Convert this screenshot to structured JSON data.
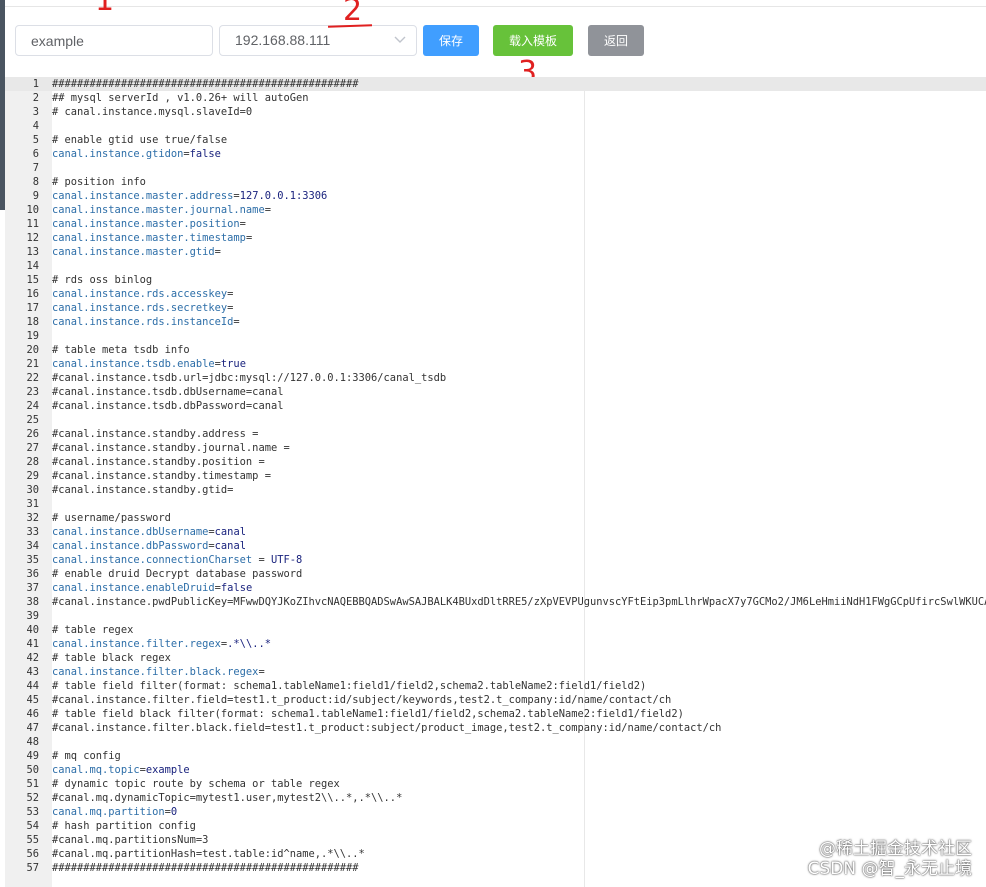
{
  "toolbar": {
    "instance_name": "example",
    "ip_selected": "192.168.88.111",
    "save_label": "保存",
    "load_template_label": "载入模板",
    "back_label": "返回"
  },
  "annotations": [
    "1",
    "2",
    "3"
  ],
  "editor": {
    "lines": [
      "#################################################",
      "## mysql serverId , v1.0.26+ will autoGen",
      "# canal.instance.mysql.slaveId=0",
      "",
      "# enable gtid use true/false",
      "canal.instance.gtidon=false",
      "",
      "# position info",
      "canal.instance.master.address=127.0.0.1:3306",
      "canal.instance.master.journal.name=",
      "canal.instance.master.position=",
      "canal.instance.master.timestamp=",
      "canal.instance.master.gtid=",
      "",
      "# rds oss binlog",
      "canal.instance.rds.accesskey=",
      "canal.instance.rds.secretkey=",
      "canal.instance.rds.instanceId=",
      "",
      "# table meta tsdb info",
      "canal.instance.tsdb.enable=true",
      "#canal.instance.tsdb.url=jdbc:mysql://127.0.0.1:3306/canal_tsdb",
      "#canal.instance.tsdb.dbUsername=canal",
      "#canal.instance.tsdb.dbPassword=canal",
      "",
      "#canal.instance.standby.address =",
      "#canal.instance.standby.journal.name =",
      "#canal.instance.standby.position =",
      "#canal.instance.standby.timestamp =",
      "#canal.instance.standby.gtid=",
      "",
      "# username/password",
      "canal.instance.dbUsername=canal",
      "canal.instance.dbPassword=canal",
      "canal.instance.connectionCharset = UTF-8",
      "# enable druid Decrypt database password",
      "canal.instance.enableDruid=false",
      "#canal.instance.pwdPublicKey=MFwwDQYJKoZIhvcNAQEBBQADSwAwSAJBALK4BUxdDltRRE5/zXpVEVPUgunvscYFtEip3pmLlhrWpacX7y7GCMo2/JM6LeHmiiNdH1FWgGCpUfircSwlWKUCAwEAAQ==",
      "",
      "# table regex",
      "canal.instance.filter.regex=.*\\\\..*",
      "# table black regex",
      "canal.instance.filter.black.regex=",
      "# table field filter(format: schema1.tableName1:field1/field2,schema2.tableName2:field1/field2)",
      "#canal.instance.filter.field=test1.t_product:id/subject/keywords,test2.t_company:id/name/contact/ch",
      "# table field black filter(format: schema1.tableName1:field1/field2,schema2.tableName2:field1/field2)",
      "#canal.instance.filter.black.field=test1.t_product:subject/product_image,test2.t_company:id/name/contact/ch",
      "",
      "# mq config",
      "canal.mq.topic=example",
      "# dynamic topic route by schema or table regex",
      "#canal.mq.dynamicTopic=mytest1.user,mytest2\\\\..*,.*\\\\..*",
      "canal.mq.partition=0",
      "# hash partition config",
      "#canal.mq.partitionsNum=3",
      "#canal.mq.partitionHash=test.table:id^name,.*\\\\..*",
      "#################################################"
    ]
  },
  "watermark": {
    "line1": "@稀土掘金技术社区",
    "line2": "CSDN @智_永无止境"
  }
}
